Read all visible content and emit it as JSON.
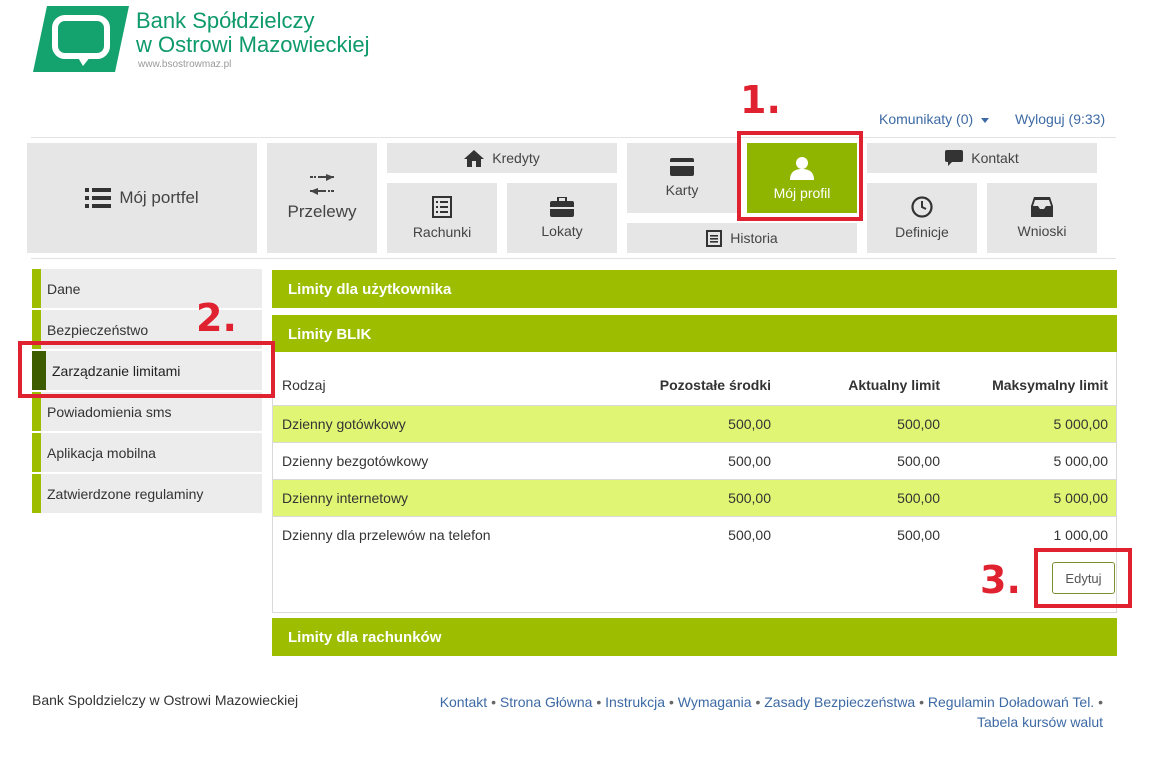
{
  "header": {
    "bank_name_line1": "Bank Spółdzielczy",
    "bank_name_line2": "w Ostrowi Mazowieckiej",
    "bank_url": "www.bsostrowmaz.pl",
    "messages_label": "Komunikaty (0)",
    "logout_label": "Wyloguj (9:33)"
  },
  "nav": {
    "portfolio": "Mój portfel",
    "transfers": "Przelewy",
    "credits": "Kredyty",
    "accounts": "Rachunki",
    "deposits": "Lokaty",
    "cards": "Karty",
    "history": "Historia",
    "profile": "Mój profil",
    "contact": "Kontakt",
    "definitions": "Definicje",
    "requests": "Wnioski"
  },
  "sidebar": {
    "items": [
      {
        "label": "Dane"
      },
      {
        "label": "Bezpieczeństwo"
      },
      {
        "label": "Zarządzanie limitami"
      },
      {
        "label": "Powiadomienia sms"
      },
      {
        "label": "Aplikacja mobilna"
      },
      {
        "label": "Zatwierdzone regulaminy"
      }
    ],
    "active_index": 2
  },
  "panels": {
    "user_limits": "Limity dla użytkownika",
    "blik_limits": "Limity BLIK",
    "account_limits": "Limity dla rachunków"
  },
  "table": {
    "headers": [
      "Rodzaj",
      "Pozostałe środki",
      "Aktualny limit",
      "Maksymalny limit"
    ],
    "rows": [
      [
        "Dzienny gotówkowy",
        "500,00",
        "500,00",
        "5 000,00"
      ],
      [
        "Dzienny bezgotówkowy",
        "500,00",
        "500,00",
        "5 000,00"
      ],
      [
        "Dzienny internetowy",
        "500,00",
        "500,00",
        "5 000,00"
      ],
      [
        "Dzienny dla przelewów na telefon",
        "500,00",
        "500,00",
        "1 000,00"
      ]
    ]
  },
  "edit_button": "Edytuj",
  "annotations": [
    "1.",
    "2.",
    "3."
  ],
  "footer": {
    "bank": "Bank Spoldzielczy w Ostrowi Mazowieckiej",
    "links": [
      "Kontakt",
      "Strona Główna",
      "Instrukcja",
      "Wymagania",
      "Zasady Bezpieczeństwa",
      "Regulamin Doładowań Tel.",
      "Tabela kursów walut"
    ],
    "separator": "•"
  },
  "colors": {
    "brand_green": "#9cbd00",
    "active_tile": "#8fb500",
    "row_highlight": "#e0f573",
    "annotation_red": "#e0212f",
    "logo_green": "#0e9a6a"
  },
  "icons": [
    "logo-icon",
    "list-icon",
    "transfer-arrows-icon",
    "home-icon",
    "ledger-icon",
    "briefcase-icon",
    "card-icon",
    "user-icon",
    "history-icon",
    "chat-icon",
    "clock-icon",
    "inbox-icon"
  ]
}
